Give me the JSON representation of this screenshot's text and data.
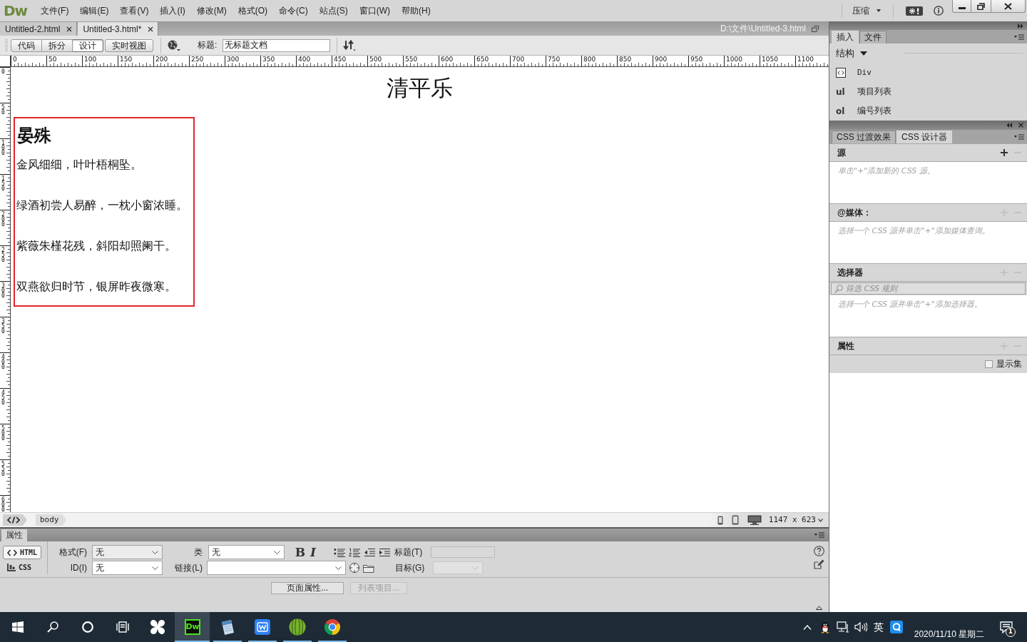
{
  "menu_bar": {
    "logo": "Dw",
    "items": [
      "文件(F)",
      "编辑(E)",
      "查看(V)",
      "插入(I)",
      "修改(M)",
      "格式(O)",
      "命令(C)",
      "站点(S)",
      "窗口(W)",
      "帮助(H)"
    ],
    "layout_menu": "压缩"
  },
  "document_tabs": [
    {
      "label": "Untitled-2.html",
      "selected": false
    },
    {
      "label": "Untitled-3.html*",
      "selected": true
    }
  ],
  "document_path": "D:\\文件\\Untitled-3.html",
  "toolbar": {
    "views": [
      {
        "label": "代码",
        "selected": false
      },
      {
        "label": "拆分",
        "selected": false
      },
      {
        "label": "设计",
        "selected": true
      },
      {
        "label": "实时视图",
        "selected": false
      }
    ],
    "title_label": "标题:",
    "title_value": "无标题文档"
  },
  "rulers": {
    "horizontal": [
      "0",
      "50",
      "100",
      "150",
      "200",
      "250",
      "300",
      "350",
      "400",
      "450",
      "500",
      "550",
      "600",
      "650",
      "700",
      "750",
      "800",
      "850",
      "900",
      "950",
      "1000",
      "1050",
      "1100"
    ],
    "vertical": [
      "0",
      "50",
      "100",
      "150",
      "200",
      "250",
      "300",
      "350",
      "400",
      "450",
      "500",
      "550",
      "600"
    ]
  },
  "document": {
    "heading": "清平乐",
    "poem": {
      "author": "晏殊",
      "lines": [
        "金风细细，叶叶梧桐坠。",
        "绿酒初尝人易醉，一枕小窗浓睡。",
        "紫薇朱槿花残，斜阳却照阑干。",
        "双燕欲归时节，银屏昨夜微寒。"
      ]
    }
  },
  "status_bar": {
    "tags": [
      "body"
    ],
    "window_size": "1147 x 623"
  },
  "properties": {
    "tab": "属性",
    "modes": [
      {
        "label": "HTML",
        "selected": true
      },
      {
        "label": "CSS",
        "selected": false
      }
    ],
    "format": {
      "label": "格式(F)",
      "value": "无"
    },
    "id": {
      "label": "ID(I)",
      "value": "无"
    },
    "class": {
      "label": "类",
      "value": "无"
    },
    "link": {
      "label": "链接(L)"
    },
    "bold_label": "B",
    "italic_label": "I",
    "title": {
      "label": "标题(T)",
      "disabled": true
    },
    "target": {
      "label": "目标(G)",
      "disabled": true
    },
    "buttons": [
      {
        "label": "页面属性...",
        "disabled": false
      },
      {
        "label": "列表项目...",
        "disabled": true
      }
    ]
  },
  "insert_panel": {
    "tabs": [
      {
        "label": "插入",
        "selected": true
      },
      {
        "label": "文件",
        "selected": false
      }
    ],
    "category": "结构",
    "items": [
      {
        "kind": "icon",
        "label": "Div"
      },
      {
        "kind": "tag",
        "tag": "ul",
        "label": "项目列表"
      },
      {
        "kind": "tag",
        "tag": "ol",
        "label": "编号列表"
      }
    ]
  },
  "css_designer": {
    "tabs": [
      {
        "label": "CSS 过渡效果",
        "selected": false
      },
      {
        "label": "CSS 设计器",
        "selected": true
      }
    ],
    "sections": [
      {
        "title": "源",
        "add_enabled": true,
        "remove_enabled": false,
        "hint": "单击\"+\"添加新的 CSS 源。"
      },
      {
        "title": "@媒体：",
        "add_enabled": false,
        "remove_enabled": false,
        "hint": "选择一个 CSS 源并单击\"+\"添加媒体查询。"
      },
      {
        "title": "选择器",
        "add_enabled": false,
        "remove_enabled": false,
        "filter_placeholder": "筛选 CSS 规则",
        "hint": "选择一个 CSS 源并单击\"+\"添加选择器。"
      },
      {
        "title": "属性",
        "add_enabled": false,
        "remove_enabled": false,
        "show_set": {
          "label": "显示集",
          "checked": false
        }
      }
    ]
  },
  "taskbar": {
    "apps": [
      {
        "kind": "start",
        "running": false,
        "selected": false
      },
      {
        "kind": "search",
        "running": false,
        "selected": false
      },
      {
        "kind": "cortana",
        "running": false,
        "selected": false
      },
      {
        "kind": "task-view",
        "running": false,
        "selected": false
      },
      {
        "kind": "pinwheel",
        "running": false,
        "selected": false
      },
      {
        "kind": "dw",
        "text": "Dw",
        "running": true,
        "selected": true
      },
      {
        "kind": "notepad",
        "running": true,
        "selected": false
      },
      {
        "kind": "wps",
        "running": true,
        "selected": false
      },
      {
        "kind": "melon",
        "running": true,
        "selected": false
      },
      {
        "kind": "chrome",
        "running": true,
        "selected": false
      }
    ],
    "tray": {
      "ime": "英",
      "date": "2020/11/10 星期二",
      "notification_count": "1"
    }
  }
}
